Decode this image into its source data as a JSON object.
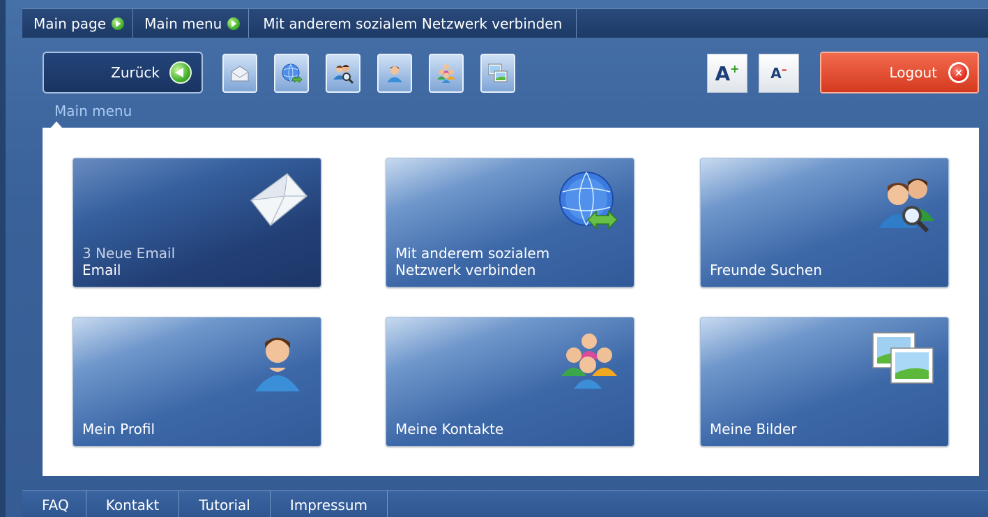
{
  "breadcrumb": {
    "items": [
      {
        "label": "Main page"
      },
      {
        "label": "Main menu"
      },
      {
        "label": "Mit anderem sozialem Netzwerk verbinden"
      }
    ]
  },
  "toolbar": {
    "back_label": "Zurück",
    "icons": [
      "email-icon",
      "globe-connect-icon",
      "find-friends-icon",
      "profile-icon",
      "contacts-icon",
      "pictures-icon"
    ],
    "font_increase_label": "A",
    "font_increase_sup": "+",
    "font_decrease_label": "A",
    "font_decrease_sup": "–",
    "logout_label": "Logout",
    "logout_icon_glyph": "×"
  },
  "section_label": "Main menu",
  "tiles": [
    {
      "sub": "3 Neue Email",
      "title": "Email",
      "icon": "envelope-icon"
    },
    {
      "title_line1": "Mit anderem sozialem",
      "title_line2": "Netzwerk verbinden",
      "icon": "globe-connect-icon"
    },
    {
      "title": "Freunde Suchen",
      "icon": "find-friends-icon"
    },
    {
      "title": "Mein Profil",
      "icon": "profile-icon"
    },
    {
      "title": "Meine Kontakte",
      "icon": "contacts-icon"
    },
    {
      "title": "Meine Bilder",
      "icon": "pictures-icon"
    }
  ],
  "footer": {
    "items": [
      "FAQ",
      "Kontakt",
      "Tutorial",
      "Impressum"
    ]
  },
  "colors": {
    "background": "#3a6199",
    "tile_blue": "#3d68a8",
    "logout_red": "#d53a20",
    "accent_green": "#46b22e"
  }
}
